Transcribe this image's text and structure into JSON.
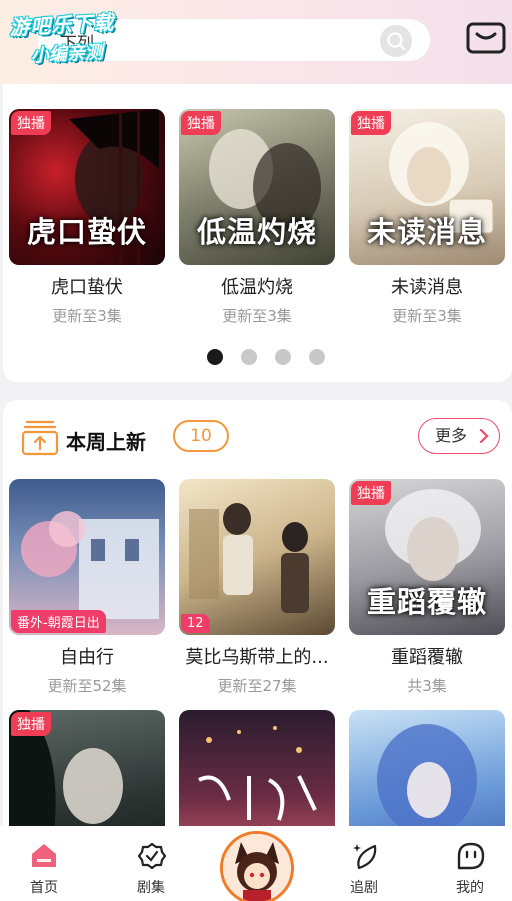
{
  "watermark": {
    "line1": "游吧乐下载",
    "line2": "小编亲测"
  },
  "search": {
    "query": "下列"
  },
  "featured": [
    {
      "cover_title": "虎口蛰伏",
      "badge": "独播",
      "name": "虎口蛰伏",
      "status": "更新至3集"
    },
    {
      "cover_title": "低温灼烧",
      "badge": "独播",
      "name": "低温灼烧",
      "status": "更新至3集"
    },
    {
      "cover_title": "未读消息",
      "badge": "独播",
      "name": "未读消息",
      "status": "更新至3集"
    }
  ],
  "carousel": {
    "page_count": 4,
    "active_index": 0
  },
  "weekly": {
    "title": "本周上新",
    "count": "10",
    "more_label": "更多",
    "items": [
      {
        "tag": "番外-朝霞日出",
        "name": "自由行",
        "status": "更新至52集"
      },
      {
        "tag": "12",
        "name": "莫比乌斯带上的...",
        "status": "更新至27集"
      },
      {
        "badge": "独播",
        "cover_title": "重蹈覆辙",
        "name": "重蹈覆辙",
        "status": "共3集"
      },
      {
        "badge": "独播"
      },
      {},
      {}
    ]
  },
  "nav": {
    "home": "首页",
    "series": "剧集",
    "follow": "追剧",
    "mine": "我的"
  },
  "colors": {
    "accent": "#ee3d55",
    "orange": "#f2973b",
    "nav_home": "#f0617d"
  }
}
